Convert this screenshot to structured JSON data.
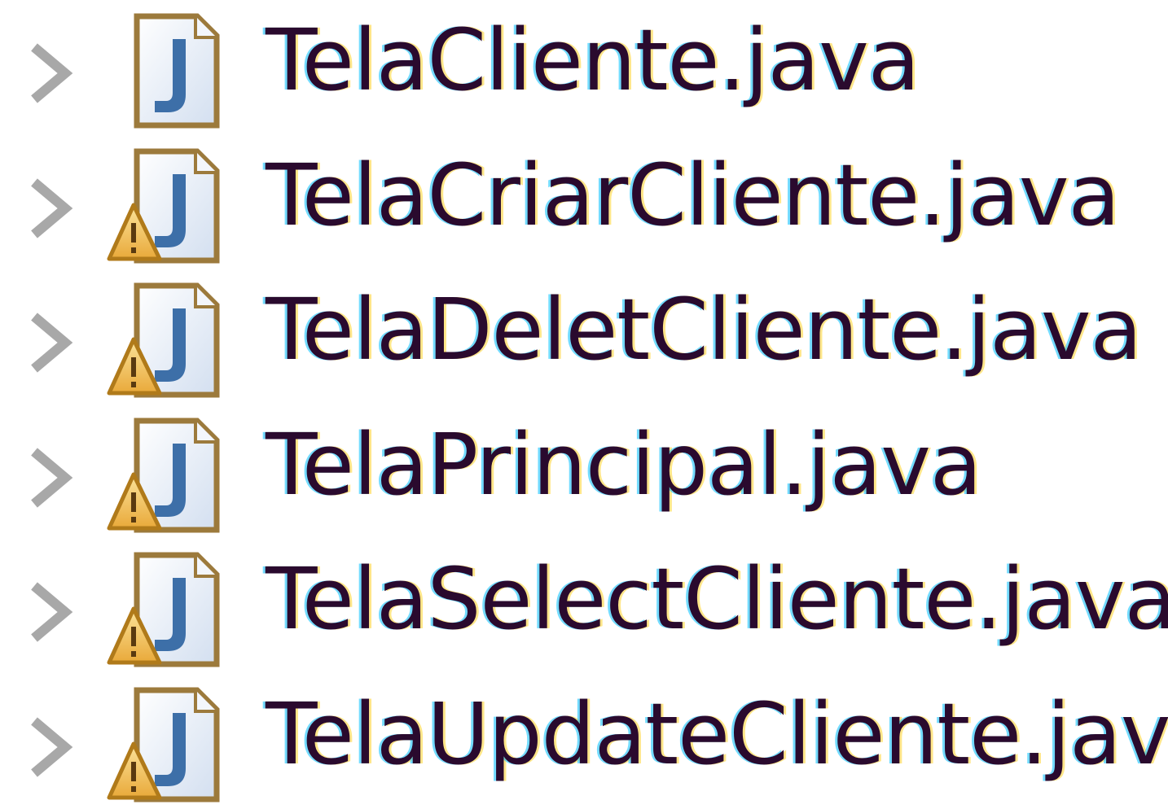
{
  "tree": {
    "items": [
      {
        "label": "TelaCliente.java",
        "icon": "java-file-icon",
        "warning": false
      },
      {
        "label": "TelaCriarCliente.java",
        "icon": "java-file-icon",
        "warning": true
      },
      {
        "label": "TelaDeletCliente.java",
        "icon": "java-file-icon",
        "warning": true
      },
      {
        "label": "TelaPrincipal.java",
        "icon": "java-file-icon",
        "warning": true
      },
      {
        "label": "TelaSelectCliente.java",
        "icon": "java-file-icon",
        "warning": true
      },
      {
        "label": "TelaUpdateCliente.java",
        "icon": "java-file-icon",
        "warning": true
      }
    ],
    "expander_icon": "chevron-right-icon",
    "warning_icon": "warning-icon"
  },
  "colors": {
    "label_text": "#2a0a2e",
    "chevron": "#a8a8a8",
    "file_border": "#9c7a3c",
    "file_fill": "#e8eef8",
    "java_glyph": "#3d6fa8",
    "warning_fill": "#f2c14e",
    "warning_border": "#b07a1a"
  }
}
